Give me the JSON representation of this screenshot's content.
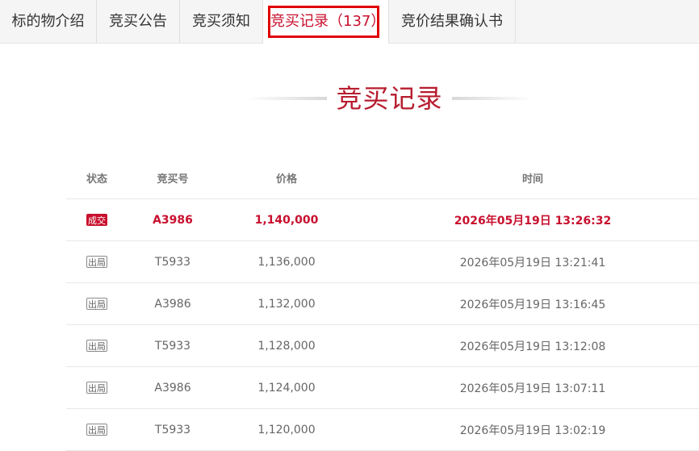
{
  "tabs": [
    {
      "label": "标的物介绍"
    },
    {
      "label": "竞买公告"
    },
    {
      "label": "竞买须知"
    },
    {
      "label": "竞买记录（137）"
    },
    {
      "label": "竞价结果确认书"
    }
  ],
  "active_tab": 3,
  "section_title": "竞买记录",
  "table": {
    "headers": {
      "status": "状态",
      "bid_no": "竞买号",
      "price": "价格",
      "time": "时间"
    },
    "rows": [
      {
        "status": "成交",
        "bid_no": "A3986",
        "price": "1,140,000",
        "time": "2026年05月19日 13:26:32"
      },
      {
        "status": "出局",
        "bid_no": "T5933",
        "price": "1,136,000",
        "time": "2026年05月19日 13:21:41"
      },
      {
        "status": "出局",
        "bid_no": "A3986",
        "price": "1,132,000",
        "time": "2026年05月19日 13:16:45"
      },
      {
        "status": "出局",
        "bid_no": "T5933",
        "price": "1,128,000",
        "time": "2026年05月19日 13:12:08"
      },
      {
        "status": "出局",
        "bid_no": "A3986",
        "price": "1,124,000",
        "time": "2026年05月19日 13:07:11"
      },
      {
        "status": "出局",
        "bid_no": "T5933",
        "price": "1,120,000",
        "time": "2026年05月19日 13:02:19"
      }
    ]
  },
  "colors": {
    "accent": "#c8102e",
    "active_tab_border": "#e00000"
  }
}
